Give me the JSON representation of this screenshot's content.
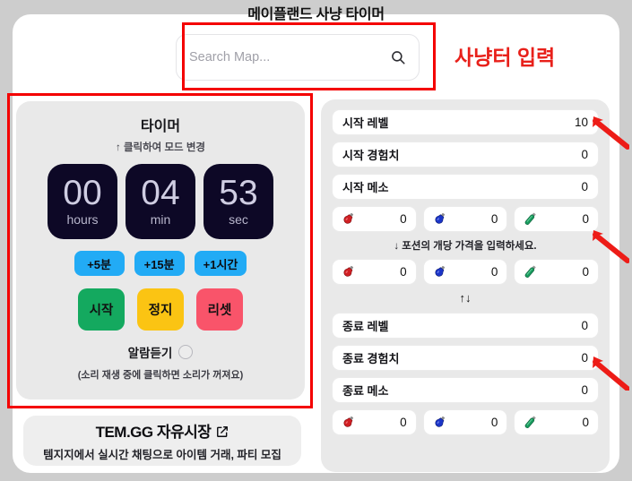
{
  "page": {
    "title": "메이플랜드 사냥 타이머"
  },
  "search": {
    "placeholder": "Search Map...",
    "value": "",
    "icon": "search-icon"
  },
  "annotations": {
    "search_label": "사냥터 입력",
    "color": "#f40000"
  },
  "timer": {
    "title": "타이머",
    "subtitle": "↑ 클릭하여 모드 변경",
    "units": [
      {
        "value": "00",
        "label": "hours"
      },
      {
        "value": "04",
        "label": "min"
      },
      {
        "value": "53",
        "label": "sec"
      }
    ],
    "quick_buttons": [
      {
        "label": "+5분",
        "color": "#22abf5"
      },
      {
        "label": "+15분",
        "color": "#22abf5"
      },
      {
        "label": "+1시간",
        "color": "#22abf5"
      }
    ],
    "controls": [
      {
        "label": "시작",
        "color": "#14a95f"
      },
      {
        "label": "정지",
        "color": "#fbc413"
      },
      {
        "label": "리셋",
        "color": "#f9546a"
      }
    ],
    "alarm_label": "알람듣기",
    "alarm_checked": false,
    "alarm_note": "(소리 재생 중에 클릭하면 소리가 꺼져요)"
  },
  "promo": {
    "title": "TEM.GG 자유시장",
    "external_icon": "external-link-icon",
    "subtitle": "템지지에서 실시간 채팅으로 아이템 거래, 파티 모집"
  },
  "stats": {
    "start_fields": [
      {
        "label": "시작 레벨",
        "value": "10"
      },
      {
        "label": "시작 경험치",
        "value": "0"
      },
      {
        "label": "시작 메소",
        "value": "0"
      }
    ],
    "start_potions": [
      {
        "icon": "red-potion-icon",
        "value": "0"
      },
      {
        "icon": "blue-potion-icon",
        "value": "0"
      },
      {
        "icon": "green-elixir-icon",
        "value": "0"
      }
    ],
    "price_hint": "↓ 포션의 개당 가격을 입력하세요.",
    "price_potions": [
      {
        "icon": "red-potion-icon",
        "value": "0"
      },
      {
        "icon": "blue-potion-icon",
        "value": "0"
      },
      {
        "icon": "green-elixir-icon",
        "value": "0"
      }
    ],
    "swap_label": "↑↓",
    "end_fields": [
      {
        "label": "종료 레벨",
        "value": "0"
      },
      {
        "label": "종료 경험치",
        "value": "0"
      },
      {
        "label": "종료 메소",
        "value": "0"
      }
    ],
    "end_potions": [
      {
        "icon": "red-potion-icon",
        "value": "0"
      },
      {
        "icon": "blue-potion-icon",
        "value": "0"
      },
      {
        "icon": "green-elixir-icon",
        "value": "0"
      }
    ]
  }
}
